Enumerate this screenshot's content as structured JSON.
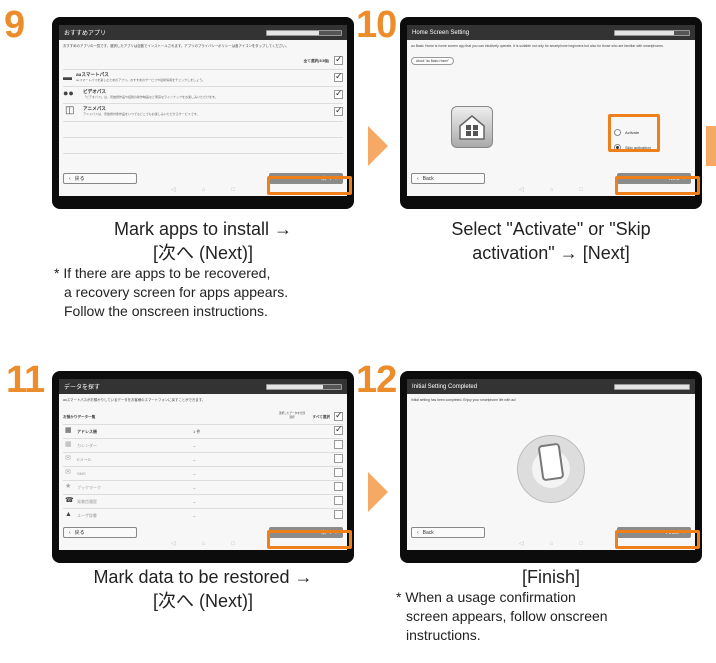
{
  "steps": [
    {
      "number": "9",
      "screen_title": "おすすめアプリ",
      "description": "おすすめのアプリの一覧です。選択したアプリは自動でインストールされます。アプリのプライバシーポリシーは各アイコンをタップしてください。",
      "select_all_label": "全て選択(3/3個)",
      "apps": [
        {
          "name": "auスマートパス",
          "desc": "auスマートパスを楽しむためのアプリ。おすすめのサービスや最新情報をチェックしましょう。"
        },
        {
          "name": "ビデオパス",
          "desc": "「ビデオパス」は、見放題作品や話題の新作映画など豊富なラインナップをお楽しみいただけます。"
        },
        {
          "name": "アニメパス",
          "desc": "アニメパスは、見放題対象作品をいつでもどこでもお楽しみいただけるサービスです。"
        }
      ],
      "back_label": "戻る",
      "next_label": "次へ",
      "caption_lines": [
        "Mark apps to install →",
        "[次へ (Next)]"
      ],
      "note_lines": [
        "* If there are apps to be recovered,",
        "a recovery screen for apps appears.",
        "Follow the onscreen instructions."
      ]
    },
    {
      "number": "10",
      "screen_title": "Home Screen Setting",
      "description": "au Basic Home is home screen app that you can intuitively operate. It is suitable not only for smartphone beginners but also for those who are familiar with smartphones.",
      "link_label": "About \"au Basic Home\"",
      "options": [
        "Activate",
        "Skip activation"
      ],
      "back_label": "Back",
      "next_label": "Next",
      "caption_lines": [
        "Select \"Activate\" or \"Skip",
        "activation\" → [Next]"
      ]
    },
    {
      "number": "11",
      "screen_title": "データを探す",
      "description": "auスマートパスがお預かりしているデータをお客様のスマートフォンに戻すことができます。",
      "col_header": "お預かりデータ一覧",
      "select_all_hint": "選択したデータを全部選択",
      "select_all_label": "すべて選択",
      "rows": [
        {
          "name": "アドレス帳",
          "count": "1 件"
        },
        {
          "name": "カレンダー",
          "count": "--"
        },
        {
          "name": "Eメール",
          "count": "--"
        },
        {
          "name": "SMS",
          "count": "--"
        },
        {
          "name": "ブックマーク",
          "count": "--"
        },
        {
          "name": "発着信履歴",
          "count": "--"
        },
        {
          "name": "ユーザ辞書",
          "count": "--"
        }
      ],
      "back_label": "戻る",
      "next_label": "次へ",
      "caption_lines": [
        "Mark data to be restored →",
        "[次へ (Next)]"
      ]
    },
    {
      "number": "12",
      "screen_title": "Initial Setting Completed",
      "description": "Initial setting has been completed. Enjoy your smartphone life with au!",
      "back_label": "Back",
      "next_label": "Finish",
      "caption_lines": [
        "[Finish]"
      ],
      "note_lines": [
        "* When a usage confirmation",
        "screen appears, follow onscreen",
        "instructions."
      ]
    }
  ],
  "colors": {
    "accent": "#ef7f1a",
    "number": "#ec8c2a",
    "arrow": "#f5a964"
  }
}
